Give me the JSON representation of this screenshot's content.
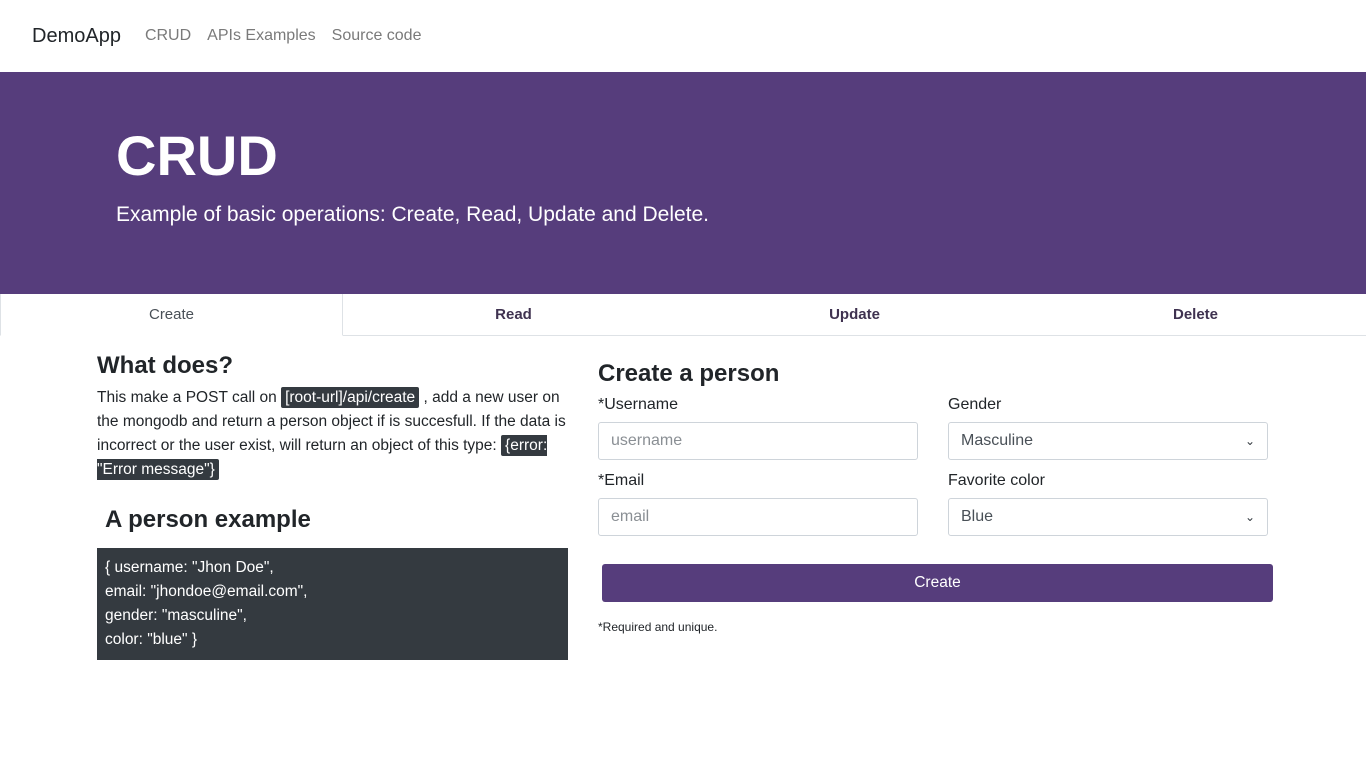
{
  "nav": {
    "brand": "DemoApp",
    "links": [
      "CRUD",
      "APIs Examples",
      "Source code"
    ]
  },
  "hero": {
    "title": "CRUD",
    "subtitle": "Example of basic operations: Create, Read, Update and Delete."
  },
  "tabs": [
    "Create",
    "Read",
    "Update",
    "Delete"
  ],
  "left": {
    "heading": "What does?",
    "desc_1": "This make a POST call on ",
    "endpoint": "[root-url]/api/create",
    "desc_2": " , add a new user on the mongodb and return a person object if is succesfull. If the data is incorrect or the user exist, will return an object of this type: ",
    "error_example": "{error: \"Error message\"}",
    "example_heading": "A person example",
    "example_lines": [
      "{ username: \"Jhon Doe\",",
      "email: \"jhondoe@email.com\",",
      "gender: \"masculine\",",
      "color: \"blue\" }"
    ]
  },
  "form": {
    "heading": "Create a person",
    "username_label": "*Username",
    "username_placeholder": "username",
    "gender_label": "Gender",
    "gender_value": "Masculine",
    "email_label": "*Email",
    "email_placeholder": "email",
    "color_label": "Favorite color",
    "color_value": "Blue",
    "submit_label": "Create",
    "note": "*Required and unique."
  },
  "colors": {
    "brand": "#563d7c",
    "code_bg": "#343a40"
  },
  "icons": [
    "chevron-down-icon"
  ]
}
